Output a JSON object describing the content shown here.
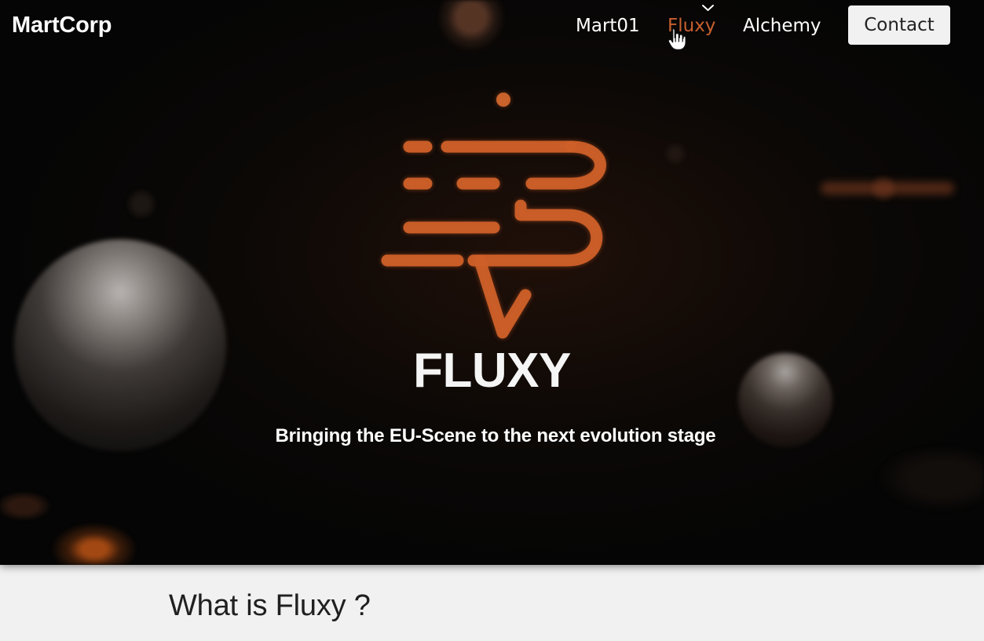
{
  "brand": {
    "name": "MartCorp"
  },
  "nav": {
    "items": [
      {
        "label": "Mart01"
      },
      {
        "label": "Fluxy"
      },
      {
        "label": "Alchemy"
      }
    ],
    "contact_label": "Contact"
  },
  "hero": {
    "title": "FLUXY",
    "subtitle": "Bringing the EU-Scene to the next evolution stage"
  },
  "section": {
    "title": "What is Fluxy ?"
  },
  "colors": {
    "accent": "#c7602f",
    "hero_background": "#050505",
    "page_background": "#f1f1f1",
    "text_light": "#ffffff",
    "text_dark": "#202020"
  },
  "icons": {
    "hero_logo": "fluxy-logo-icon",
    "cursor": "hand-cursor-icon",
    "hover_indicator": "chevron-down-icon"
  }
}
